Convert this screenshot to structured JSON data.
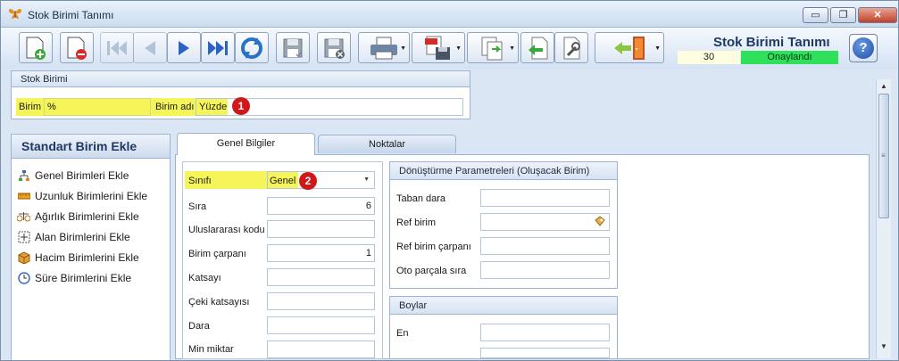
{
  "window": {
    "title": "Stok Birimi Tanımı",
    "controls": {
      "minimize": "▭",
      "maximize": "❐",
      "close": "✕"
    }
  },
  "header": {
    "form_title": "Stok Birimi Tanımı",
    "record_number": "30",
    "status": "Onaylandı",
    "status_color": "#2fe05a"
  },
  "toolbar_icons": [
    "new-record-icon",
    "delete-record-icon",
    "first-record-icon",
    "previous-record-icon",
    "next-record-icon",
    "last-record-icon",
    "refresh-icon",
    "save-icon",
    "cancel-icon",
    "print-icon",
    "export-pdf-icon",
    "copy-document-icon",
    "back-icon",
    "tools-icon",
    "exit-icon",
    "help-icon"
  ],
  "stok_birimi": {
    "group_title": "Stok Birimi",
    "birim_label": "Birim",
    "birim_value": "%",
    "birim_adi_label": "Birim adı",
    "birim_adi_value": "Yüzde",
    "badge": "1"
  },
  "sidebar": {
    "title": "Standart Birim Ekle",
    "items": [
      {
        "label": "Genel Birimleri Ekle",
        "icon": "sitemap-icon"
      },
      {
        "label": "Uzunluk Birimlerini Ekle",
        "icon": "ruler-icon"
      },
      {
        "label": "Ağırlık Birimlerini Ekle",
        "icon": "weights-icon"
      },
      {
        "label": "Alan Birimlerini Ekle",
        "icon": "area-icon"
      },
      {
        "label": "Hacim Birimlerini Ekle",
        "icon": "box-icon"
      },
      {
        "label": "Süre Birimlerini Ekle",
        "icon": "clock-icon"
      }
    ]
  },
  "tabs": [
    {
      "label": "Genel Bilgiler",
      "active": true
    },
    {
      "label": "Noktalar",
      "active": false
    }
  ],
  "genel": {
    "sinifi_label": "Sınıfı",
    "sinifi_value": "Genel",
    "badge": "2",
    "sira_label": "Sıra",
    "sira_value": "6",
    "uluslararasi_label": "Uluslararası kodu",
    "uluslararasi_value": "",
    "carpan_label": "Birim çarpanı",
    "carpan_value": "1",
    "katsayi_label": "Katsayı",
    "ceki_label": "Çeki katsayısı",
    "dara_label": "Dara",
    "min_label": "Min miktar"
  },
  "donusturme": {
    "title": "Dönüştürme Parametreleri (Oluşacak Birim)",
    "taban_label": "Taban dara",
    "ref_birim_label": "Ref birim",
    "ref_carpan_label": "Ref birim çarpanı",
    "oto_label": "Oto parçala sıra"
  },
  "boylar": {
    "title": "Boylar",
    "en_label": "En"
  }
}
